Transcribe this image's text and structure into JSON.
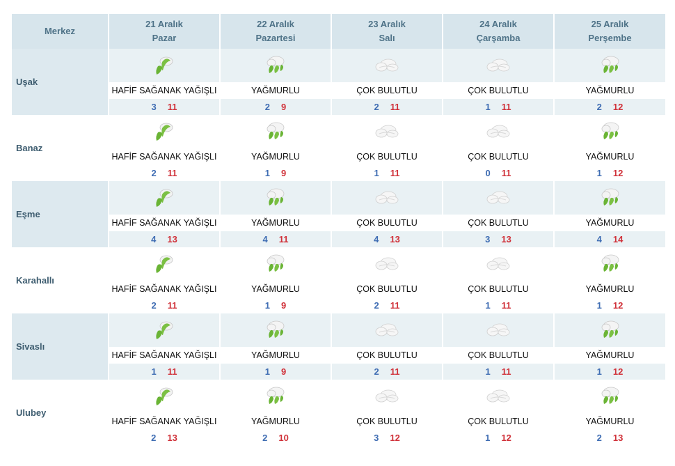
{
  "header": {
    "city_col": "Merkez",
    "days": [
      {
        "date": "21 Aralık",
        "weekday": "Pazar"
      },
      {
        "date": "22 Aralık",
        "weekday": "Pazartesi"
      },
      {
        "date": "23 Aralık",
        "weekday": "Salı"
      },
      {
        "date": "24 Aralık",
        "weekday": "Çarşamba"
      },
      {
        "date": "25 Aralık",
        "weekday": "Perşembe"
      }
    ]
  },
  "colors": {
    "low": "#3f6db3",
    "high": "#d0323a",
    "header_bg": "#d7e5ec",
    "header_text": "#4f7388"
  },
  "rows": [
    {
      "city": "Uşak",
      "days": [
        {
          "icon": "light-shower-icon",
          "condition": "HAFİF SAĞANAK YAĞIŞLI",
          "low": "3",
          "high": "11"
        },
        {
          "icon": "rain-icon",
          "condition": "YAĞMURLU",
          "low": "2",
          "high": "9"
        },
        {
          "icon": "cloudy-icon",
          "condition": "ÇOK BULUTLU",
          "low": "2",
          "high": "11"
        },
        {
          "icon": "cloudy-icon",
          "condition": "ÇOK BULUTLU",
          "low": "1",
          "high": "11"
        },
        {
          "icon": "rain-icon",
          "condition": "YAĞMURLU",
          "low": "2",
          "high": "12"
        }
      ]
    },
    {
      "city": "Banaz",
      "days": [
        {
          "icon": "light-shower-icon",
          "condition": "HAFİF SAĞANAK YAĞIŞLI",
          "low": "2",
          "high": "11"
        },
        {
          "icon": "rain-icon",
          "condition": "YAĞMURLU",
          "low": "1",
          "high": "9"
        },
        {
          "icon": "cloudy-icon",
          "condition": "ÇOK BULUTLU",
          "low": "1",
          "high": "11"
        },
        {
          "icon": "cloudy-icon",
          "condition": "ÇOK BULUTLU",
          "low": "0",
          "high": "11"
        },
        {
          "icon": "rain-icon",
          "condition": "YAĞMURLU",
          "low": "1",
          "high": "12"
        }
      ]
    },
    {
      "city": "Eşme",
      "days": [
        {
          "icon": "light-shower-icon",
          "condition": "HAFİF SAĞANAK YAĞIŞLI",
          "low": "4",
          "high": "13"
        },
        {
          "icon": "rain-icon",
          "condition": "YAĞMURLU",
          "low": "4",
          "high": "11"
        },
        {
          "icon": "cloudy-icon",
          "condition": "ÇOK BULUTLU",
          "low": "4",
          "high": "13"
        },
        {
          "icon": "cloudy-icon",
          "condition": "ÇOK BULUTLU",
          "low": "3",
          "high": "13"
        },
        {
          "icon": "rain-icon",
          "condition": "YAĞMURLU",
          "low": "4",
          "high": "14"
        }
      ]
    },
    {
      "city": "Karahallı",
      "days": [
        {
          "icon": "light-shower-icon",
          "condition": "HAFİF SAĞANAK YAĞIŞLI",
          "low": "2",
          "high": "11"
        },
        {
          "icon": "rain-icon",
          "condition": "YAĞMURLU",
          "low": "1",
          "high": "9"
        },
        {
          "icon": "cloudy-icon",
          "condition": "ÇOK BULUTLU",
          "low": "2",
          "high": "11"
        },
        {
          "icon": "cloudy-icon",
          "condition": "ÇOK BULUTLU",
          "low": "1",
          "high": "11"
        },
        {
          "icon": "rain-icon",
          "condition": "YAĞMURLU",
          "low": "1",
          "high": "12"
        }
      ]
    },
    {
      "city": "Sivaslı",
      "days": [
        {
          "icon": "light-shower-icon",
          "condition": "HAFİF SAĞANAK YAĞIŞLI",
          "low": "1",
          "high": "11"
        },
        {
          "icon": "rain-icon",
          "condition": "YAĞMURLU",
          "low": "1",
          "high": "9"
        },
        {
          "icon": "cloudy-icon",
          "condition": "ÇOK BULUTLU",
          "low": "2",
          "high": "11"
        },
        {
          "icon": "cloudy-icon",
          "condition": "ÇOK BULUTLU",
          "low": "1",
          "high": "11"
        },
        {
          "icon": "rain-icon",
          "condition": "YAĞMURLU",
          "low": "1",
          "high": "12"
        }
      ]
    },
    {
      "city": "Ulubey",
      "days": [
        {
          "icon": "light-shower-icon",
          "condition": "HAFİF SAĞANAK YAĞIŞLI",
          "low": "2",
          "high": "13"
        },
        {
          "icon": "rain-icon",
          "condition": "YAĞMURLU",
          "low": "2",
          "high": "10"
        },
        {
          "icon": "cloudy-icon",
          "condition": "ÇOK BULUTLU",
          "low": "3",
          "high": "12"
        },
        {
          "icon": "cloudy-icon",
          "condition": "ÇOK BULUTLU",
          "low": "1",
          "high": "12"
        },
        {
          "icon": "rain-icon",
          "condition": "YAĞMURLU",
          "low": "2",
          "high": "13"
        }
      ]
    }
  ]
}
